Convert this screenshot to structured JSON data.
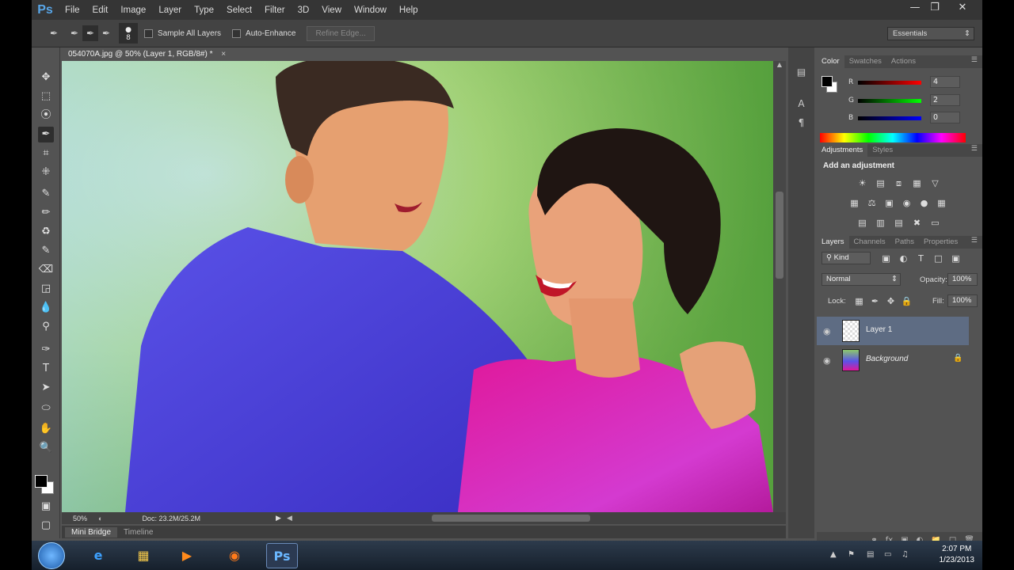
{
  "app": {
    "logo": "Ps",
    "menu": [
      "File",
      "Edit",
      "Image",
      "Layer",
      "Type",
      "Select",
      "Filter",
      "3D",
      "View",
      "Window",
      "Help"
    ],
    "window_controls": [
      "minimize-icon",
      "restore-icon",
      "close-icon"
    ]
  },
  "options": {
    "brush_size": "8",
    "sample_all_layers": "Sample All Layers",
    "auto_enhance": "Auto-Enhance",
    "refine_edge": "Refine Edge...",
    "workspace": "Essentials"
  },
  "document": {
    "tab_title": "054070A.jpg @ 50% (Layer 1, RGB/8#) *",
    "close": "×",
    "zoom": "50%",
    "doc_size": "Doc: 23.2M/25.2M"
  },
  "bottom_tabs": [
    "Mini Bridge",
    "Timeline"
  ],
  "color_panel": {
    "tabs": [
      "Color",
      "Swatches",
      "Actions"
    ],
    "channels": [
      {
        "label": "R",
        "value": "4",
        "color": "#d21e1e"
      },
      {
        "label": "G",
        "value": "2",
        "color": "#22b022"
      },
      {
        "label": "B",
        "value": "0",
        "color": "#2a3fd8"
      }
    ]
  },
  "adjustments_panel": {
    "tabs": [
      "Adjustments",
      "Styles"
    ],
    "title": "Add an adjustment"
  },
  "layers_panel": {
    "tabs": [
      "Layers",
      "Channels",
      "Paths",
      "Properties"
    ],
    "kind": "Kind",
    "blend_mode": "Normal",
    "opacity_label": "Opacity:",
    "opacity": "100%",
    "lock_label": "Lock:",
    "fill_label": "Fill:",
    "fill": "100%",
    "layers": [
      {
        "name": "Layer 1",
        "selected": true
      },
      {
        "name": "Background",
        "selected": false
      }
    ]
  },
  "taskbar": {
    "time": "2:07 PM",
    "date": "1/23/2013"
  }
}
